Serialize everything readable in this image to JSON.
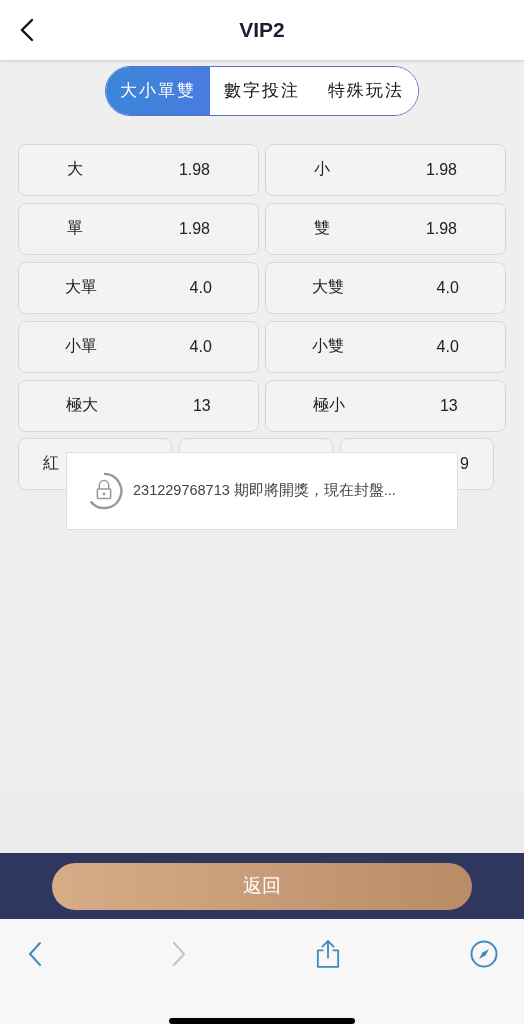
{
  "header": {
    "title": "VIP2"
  },
  "tabs": [
    {
      "label": "大小單雙",
      "selected": true
    },
    {
      "label": "數字投注",
      "selected": false
    },
    {
      "label": "特殊玩法",
      "selected": false
    }
  ],
  "bets": [
    {
      "label": "大",
      "odds": "1.98"
    },
    {
      "label": "小",
      "odds": "1.98"
    },
    {
      "label": "單",
      "odds": "1.98"
    },
    {
      "label": "雙",
      "odds": "1.98"
    },
    {
      "label": "大單",
      "odds": "4.0"
    },
    {
      "label": "大雙",
      "odds": "4.0"
    },
    {
      "label": "小單",
      "odds": "4.0"
    },
    {
      "label": "小雙",
      "odds": "4.0"
    },
    {
      "label": "極大",
      "odds": "13"
    },
    {
      "label": "極小",
      "odds": "13"
    }
  ],
  "wave_bets": [
    {
      "kind": "option",
      "label": "紅"
    },
    {
      "kind": "covered"
    },
    {
      "kind": "option",
      "odds": "9"
    }
  ],
  "toast": {
    "message": "231229768713 期即將開獎，現在封盤..."
  },
  "footer": {
    "button": "返回"
  },
  "browser_toolbar": {
    "forward_disabled": true
  }
}
